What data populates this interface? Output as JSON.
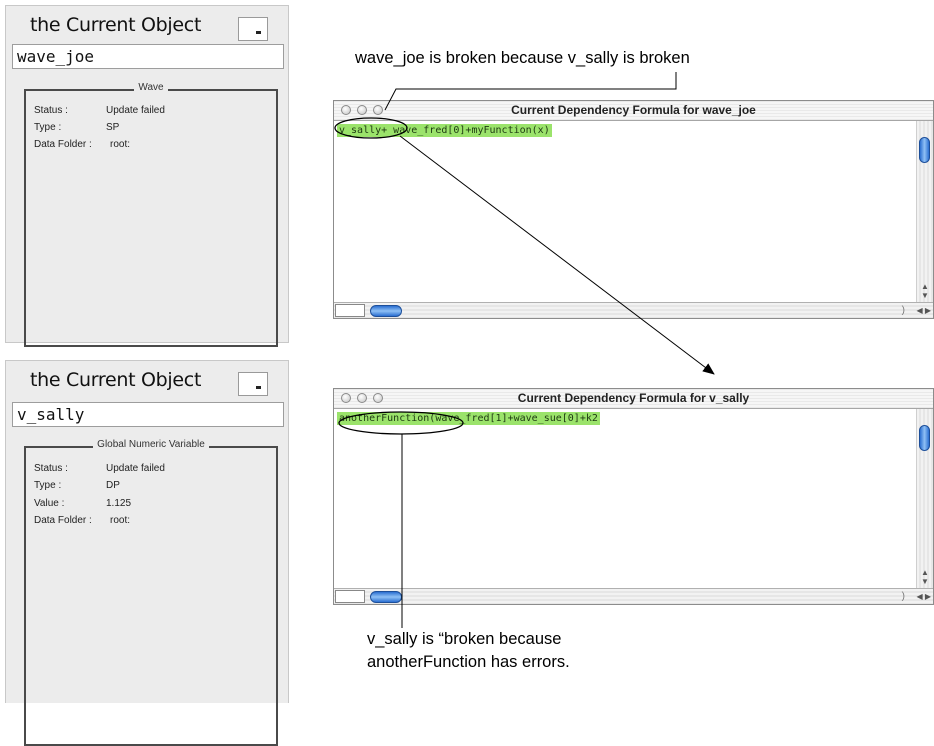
{
  "top_panel": {
    "title": "the Current Object",
    "name": "wave_joe",
    "group_title": "Wave",
    "props": [
      {
        "label": "Status :",
        "value": "Update failed"
      },
      {
        "label": "Type :",
        "value": "SP"
      },
      {
        "label": "Data Folder :",
        "value": "root:"
      }
    ]
  },
  "bottom_panel": {
    "title": "the Current Object",
    "name": "v_sally",
    "group_title": "Global Numeric Variable",
    "props": [
      {
        "label": "Status :",
        "value": "Update failed"
      },
      {
        "label": "Type :",
        "value": "DP"
      },
      {
        "label": "Value :",
        "value": "1.125"
      },
      {
        "label": "Data Folder :",
        "value": "root:"
      }
    ]
  },
  "window1": {
    "title": "Current Dependency Formula for wave_joe",
    "formula": "v_sally+ wave_fred[0]+myFunction(x)"
  },
  "window2": {
    "title": "Current Dependency Formula for v_sally",
    "formula": "anotherFunction(wave_fred[1]+wave_sue[0]+k2"
  },
  "annotations": {
    "top": "wave_joe is broken because v_sally is broken",
    "bottom_line1": "v_sally is “broken because",
    "bottom_line2": "anotherFunction has errors."
  },
  "colors": {
    "formula_highlight": "#9be36b",
    "scroll_thumb": "#2b6fd1"
  }
}
